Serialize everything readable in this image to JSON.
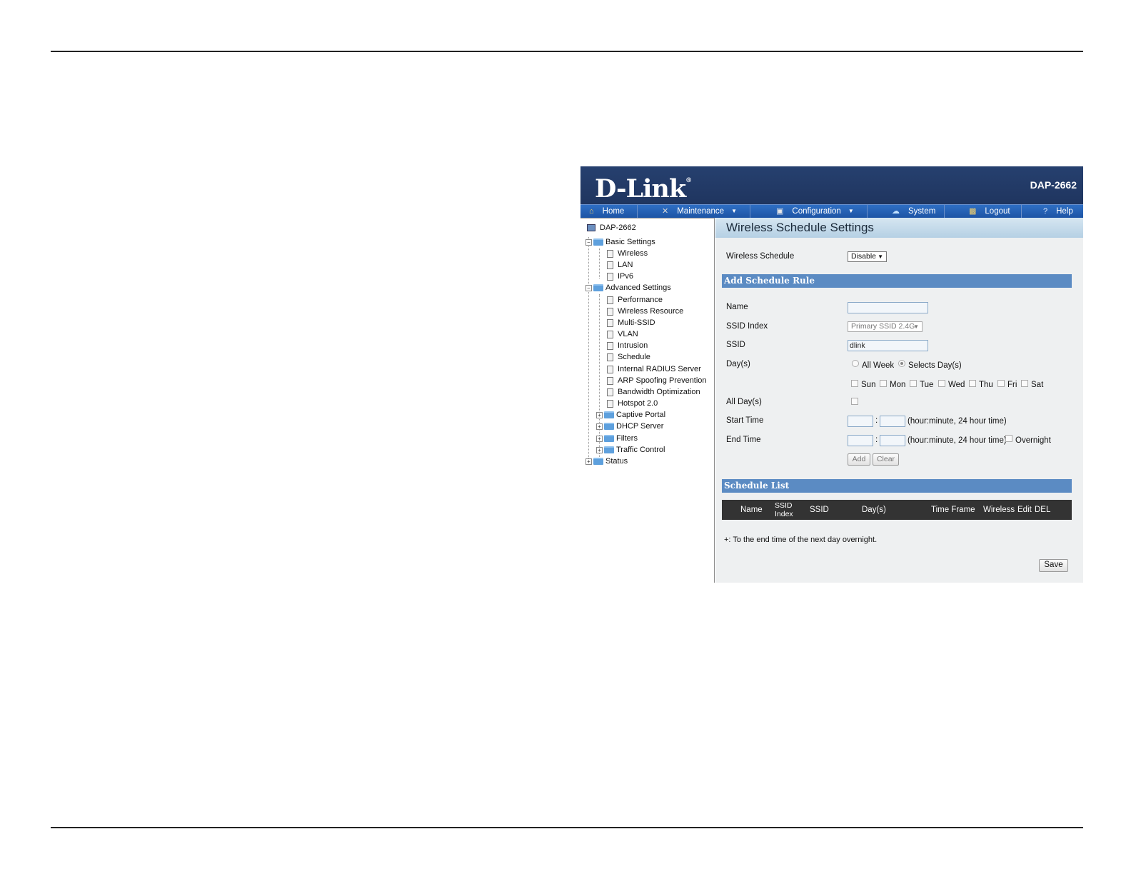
{
  "banner": {
    "logo": "D-Link",
    "model": "DAP-2662"
  },
  "nav": [
    {
      "label": "Home",
      "icon": "home-icon"
    },
    {
      "label": "Maintenance",
      "icon": "tools-icon"
    },
    {
      "label": "Configuration",
      "icon": "save-icon"
    },
    {
      "label": "System",
      "icon": "network-icon"
    },
    {
      "label": "Logout",
      "icon": "key-icon"
    },
    {
      "label": "Help",
      "icon": "help-icon"
    }
  ],
  "tree": {
    "root": "DAP-2662",
    "basic": "Basic Settings",
    "basic_items": [
      "Wireless",
      "LAN",
      "IPv6"
    ],
    "advanced": "Advanced Settings",
    "advanced_items": [
      "Performance",
      "Wireless Resource",
      "Multi-SSID",
      "VLAN",
      "Intrusion",
      "Schedule",
      "Internal RADIUS Server",
      "ARP Spoofing Prevention",
      "Bandwidth Optimization",
      "Hotspot 2.0"
    ],
    "advanced_folders": [
      "Captive Portal",
      "DHCP Server",
      "Filters",
      "Traffic Control"
    ],
    "status": "Status"
  },
  "main": {
    "title": "Wireless Schedule Settings",
    "wireless_schedule_label": "Wireless Schedule",
    "wireless_schedule_value": "Disable",
    "add_rule_title": "Add Schedule Rule",
    "name_label": "Name",
    "name_value": "",
    "ssid_index_label": "SSID Index",
    "ssid_index_value": "Primary SSID 2.4G",
    "ssid_label": "SSID",
    "ssid_value": "dlink",
    "days_label": "Day(s)",
    "all_week": "All Week",
    "selects_days": "Selects Day(s)",
    "weekdays": [
      "Sun",
      "Mon",
      "Tue",
      "Wed",
      "Thu",
      "Fri",
      "Sat"
    ],
    "all_days_label": "All Day(s)",
    "start_time_label": "Start Time",
    "end_time_label": "End Time",
    "time_hint": "(hour:minute, 24 hour time)",
    "colon": ":",
    "overnight": "Overnight",
    "add_button": "Add",
    "clear_button": "Clear",
    "schedule_list_title": "Schedule List",
    "list_columns": {
      "name": "Name",
      "ssid_index_line1": "SSID",
      "ssid_index_line2": "Index",
      "ssid": "SSID",
      "days": "Day(s)",
      "time_frame": "Time Frame",
      "wireless": "Wireless",
      "edit": "Edit",
      "del": "DEL"
    },
    "note": "+: To the end time of the next day overnight.",
    "save_button": "Save"
  }
}
